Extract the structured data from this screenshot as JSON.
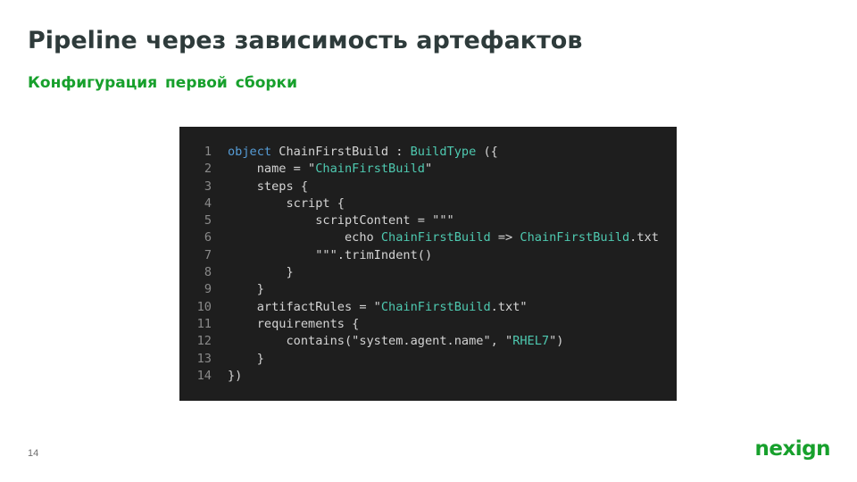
{
  "slide": {
    "title": "Pipeline через зависимость артефактов",
    "subtitle": "Конфигурация первой сборки",
    "page_number": "14",
    "logo": "nexign"
  },
  "code": {
    "lines": [
      {
        "n": "1",
        "tokens": [
          {
            "t": "object",
            "c": "kw"
          },
          {
            "t": " ChainFirstBuild : ",
            "c": "plain"
          },
          {
            "t": "BuildType",
            "c": "type"
          },
          {
            "t": " ({",
            "c": "plain"
          }
        ]
      },
      {
        "n": "2",
        "tokens": [
          {
            "t": "    name = \"",
            "c": "plain"
          },
          {
            "t": "ChainFirstBuild",
            "c": "name"
          },
          {
            "t": "\"",
            "c": "plain"
          }
        ]
      },
      {
        "n": "3",
        "tokens": [
          {
            "t": "    steps {",
            "c": "plain"
          }
        ]
      },
      {
        "n": "4",
        "tokens": [
          {
            "t": "        script {",
            "c": "plain"
          }
        ]
      },
      {
        "n": "5",
        "tokens": [
          {
            "t": "            scriptContent = \"\"\"",
            "c": "plain"
          }
        ]
      },
      {
        "n": "6",
        "tokens": [
          {
            "t": "                echo ",
            "c": "plain"
          },
          {
            "t": "ChainFirstBuild",
            "c": "name"
          },
          {
            "t": " => ",
            "c": "plain"
          },
          {
            "t": "ChainFirstBuild",
            "c": "name"
          },
          {
            "t": ".txt",
            "c": "plain"
          }
        ]
      },
      {
        "n": "7",
        "tokens": [
          {
            "t": "            \"\"\".trimIndent()",
            "c": "plain"
          }
        ]
      },
      {
        "n": "8",
        "tokens": [
          {
            "t": "        }",
            "c": "plain"
          }
        ]
      },
      {
        "n": "9",
        "tokens": [
          {
            "t": "    }",
            "c": "plain"
          }
        ]
      },
      {
        "n": "10",
        "tokens": [
          {
            "t": "    artifactRules = \"",
            "c": "plain"
          },
          {
            "t": "ChainFirstBuild",
            "c": "name"
          },
          {
            "t": ".txt\"",
            "c": "plain"
          }
        ]
      },
      {
        "n": "11",
        "tokens": [
          {
            "t": "    requirements {",
            "c": "plain"
          }
        ]
      },
      {
        "n": "12",
        "tokens": [
          {
            "t": "        contains(\"system.agent.name\", \"",
            "c": "plain"
          },
          {
            "t": "RHEL7",
            "c": "name"
          },
          {
            "t": "\")",
            "c": "plain"
          }
        ]
      },
      {
        "n": "13",
        "tokens": [
          {
            "t": "    }",
            "c": "plain"
          }
        ]
      },
      {
        "n": "14",
        "tokens": [
          {
            "t": "})",
            "c": "plain"
          }
        ]
      }
    ]
  }
}
